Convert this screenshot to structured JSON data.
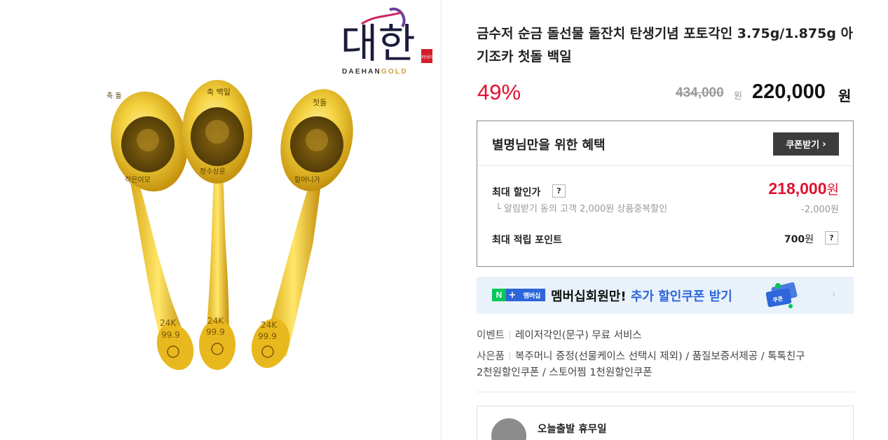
{
  "brand": {
    "logo_korean": "대한",
    "logo_sub_main": "DAEHAN",
    "logo_sub_accent": "GOLD",
    "seal_text": "대한골드"
  },
  "product_image": {
    "spoon_1": {
      "top_text": "축 돌",
      "bottom_text": "작은이모",
      "hallmark_1": "24K",
      "hallmark_2": "99.9"
    },
    "spoon_2": {
      "top_text": "축 백일",
      "bottom_text": "정수상윤",
      "hallmark_1": "24K",
      "hallmark_2": "99.9"
    },
    "spoon_3": {
      "top_text": "첫돌",
      "bottom_text": "할머니가",
      "hallmark_1": "24K",
      "hallmark_2": "99.9"
    }
  },
  "product": {
    "title": "금수저 순금 돌선물 돌잔치 탄생기념 포토각인 3.75g/1.875g 아기조카 첫돌 백일",
    "discount_rate": "49%",
    "original_price": "434,000",
    "original_unit": "원",
    "sale_price": "220,000",
    "sale_unit": "원"
  },
  "benefit": {
    "title": "별명님만을 위한 혜택",
    "coupon_button": "쿠폰받기",
    "max_discount_label": "최대 할인가",
    "help_glyph": "?",
    "max_discount_price": "218,000",
    "max_discount_unit": "원",
    "sub_note": "└  알림받기 동의 고객 2,000원 상품중복할인",
    "sub_amount": "-2,000원",
    "points_label": "최대 적립 포인트",
    "points_value": "700",
    "points_unit": "원"
  },
  "membership": {
    "n_badge": "N",
    "plus_badge": "+",
    "mem_badge": "멤버십",
    "text_main": "멤버십회원만!",
    "text_accent": "추가 할인쿠폰 받기",
    "coupon_icon_label": "쿠폰",
    "arrow": "›"
  },
  "info": {
    "event_key": "이벤트",
    "event_value": "레이저각인(문구) 무료 서비스",
    "gift_key": "사은품",
    "gift_value_1": "복주머니 증정(선물케이스 선택시 제외) / 품질보증서제공 / 톡톡친구",
    "gift_value_2": "2천원할인쿠폰 / 스토어찜 1천원할인쿠폰"
  },
  "delivery": {
    "title": "오늘출발 휴무일"
  },
  "colors": {
    "discount_red": "#e0122f",
    "gold_light": "#f4d65a",
    "gold_dark": "#c89a12",
    "naver_green": "#03c75a",
    "membership_blue": "#2e66d9"
  }
}
